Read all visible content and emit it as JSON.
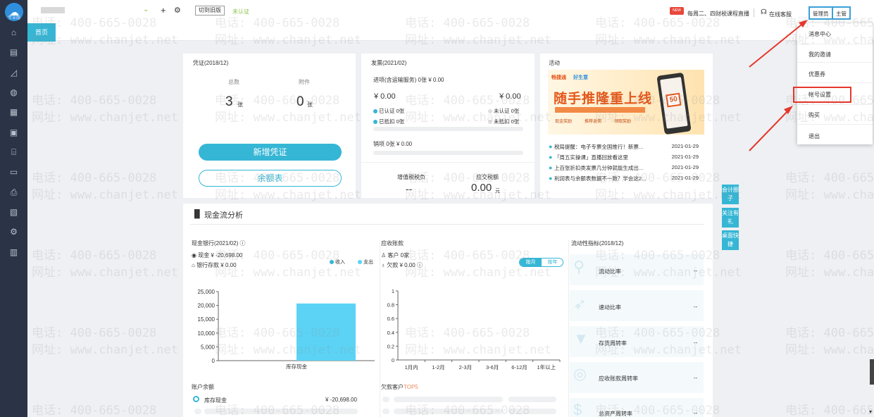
{
  "app": {
    "logo_text": "专业版",
    "logo_glyph": "☁"
  },
  "sidebar": {
    "icons": [
      "home-icon",
      "voucher-icon",
      "chart-icon",
      "money-bag-icon",
      "building-icon",
      "image-icon",
      "store-icon",
      "invoice-icon",
      "printer-icon",
      "report-icon",
      "settings-icon",
      "calendar-icon"
    ]
  },
  "topbar": {
    "add_label": "+",
    "gear_label": "⚙",
    "switch_btn": "切到旧版",
    "cert_status": "未认证",
    "live_badge": "NEW",
    "live_text": "每周二、四财税课程直播",
    "service_text": "在线客服",
    "admin_btn": "管理员",
    "supervisor_btn": "主管"
  },
  "tabs": {
    "home": "首页"
  },
  "voucher": {
    "title": "凭证(2018/12)",
    "total_label": "总数",
    "attach_label": "附件",
    "total_value": "3",
    "total_unit": "张",
    "attach_value": "0",
    "attach_unit": "张",
    "new_btn": "新增凭证",
    "balance_btn": "余额表"
  },
  "invoice": {
    "title": "发票(2021/02)",
    "input_line": "进项(含运输服务)  0张  ¥ 0.00",
    "left_amount": "¥ 0.00",
    "right_amount": "¥ 0.00",
    "certified": "已认证  0张",
    "uncertified": "未认证  0张",
    "deducted": "已抵扣  0张",
    "undeducted": "未抵扣  0张",
    "sales_line": "销项   0张   ¥ 0.00",
    "vat_label": "增值税税负",
    "vat_value": "--",
    "tax_label": "应交税额",
    "tax_value": "0.00",
    "tax_unit": "元"
  },
  "activity": {
    "title": "活动",
    "banner_brand": "畅捷通",
    "banner_sub": "好生意",
    "banner_main": "随手推隆重上线",
    "banner_badge": "50",
    "banner_tags": [
      "现金奖励",
      "推荐返佣",
      "领取奖励"
    ],
    "news": [
      {
        "text": "税局提醒：电子专票全国推行！新票...",
        "date": "2021-01-29"
      },
      {
        "text": "「周五实操课」直播回放看这里",
        "date": "2021-01-29"
      },
      {
        "text": "上百张折扣类发票几分钟就能生成出...",
        "date": "2021-01-29"
      },
      {
        "text": "利润表与余额表数据不一致？学会这2...",
        "date": "2021-01-29"
      }
    ]
  },
  "float_buttons": [
    {
      "label": "会计圈子"
    },
    {
      "label": "关注有礼"
    },
    {
      "label": "桌面快捷"
    }
  ],
  "cashflow": {
    "title": "现金流分析",
    "bank_title": "现金银行(2021/02)",
    "cash_line": "现金  ¥ -20,698.00",
    "bank_line": "银行存款  ¥ 0.00",
    "legend_in": "收入",
    "legend_out": "支出",
    "color_in": "#36b6d5",
    "color_out": "#5cd3f5",
    "ar_title": "应收账款",
    "ar_customers": "客户  0家",
    "ar_owed": "欠款  ¥ 0.00",
    "toggle_month": "按月",
    "toggle_year": "按年",
    "liq_title": "流动性指标(2018/12)",
    "ratios": [
      {
        "label": "流动比率",
        "value": "--"
      },
      {
        "label": "速动比率",
        "value": "--"
      },
      {
        "label": "存货周转率",
        "value": "--"
      },
      {
        "label": "应收账款周转率",
        "value": "--"
      },
      {
        "label": "总资产周转率",
        "value": "--"
      }
    ],
    "acct_title": "账户余额",
    "acct_name": "库存现金",
    "acct_value": "¥ -20,698.00",
    "debt_title": "欠款客户",
    "debt_top": "TOP5"
  },
  "chart_data": [
    {
      "type": "bar",
      "categories": [
        "库存现金"
      ],
      "series": [
        {
          "name": "收入",
          "values": [
            0
          ]
        },
        {
          "name": "支出",
          "values": [
            20698
          ]
        }
      ],
      "ylim": [
        0,
        25000
      ],
      "yticks": [
        "0",
        "5,000",
        "10,000",
        "15,000",
        "20,000",
        "25,000"
      ]
    },
    {
      "type": "bar",
      "categories": [
        "1月内",
        "1-2月",
        "2-3月",
        "3-6月",
        "6-12月",
        "1年以上"
      ],
      "values": [
        0,
        0,
        0,
        0,
        0,
        0
      ],
      "ylim": [
        0,
        1
      ],
      "yticks": [
        "0",
        "0.2",
        "0.4",
        "0.6",
        "0.8",
        "1"
      ]
    }
  ],
  "dropdown": {
    "items": [
      "消息中心",
      "我的邀请",
      "优惠券",
      "帐号设置",
      "购买",
      "退出"
    ]
  },
  "watermark": {
    "phone": "电话: 400-665-0028",
    "site": "网址: www.chanjet.net"
  }
}
